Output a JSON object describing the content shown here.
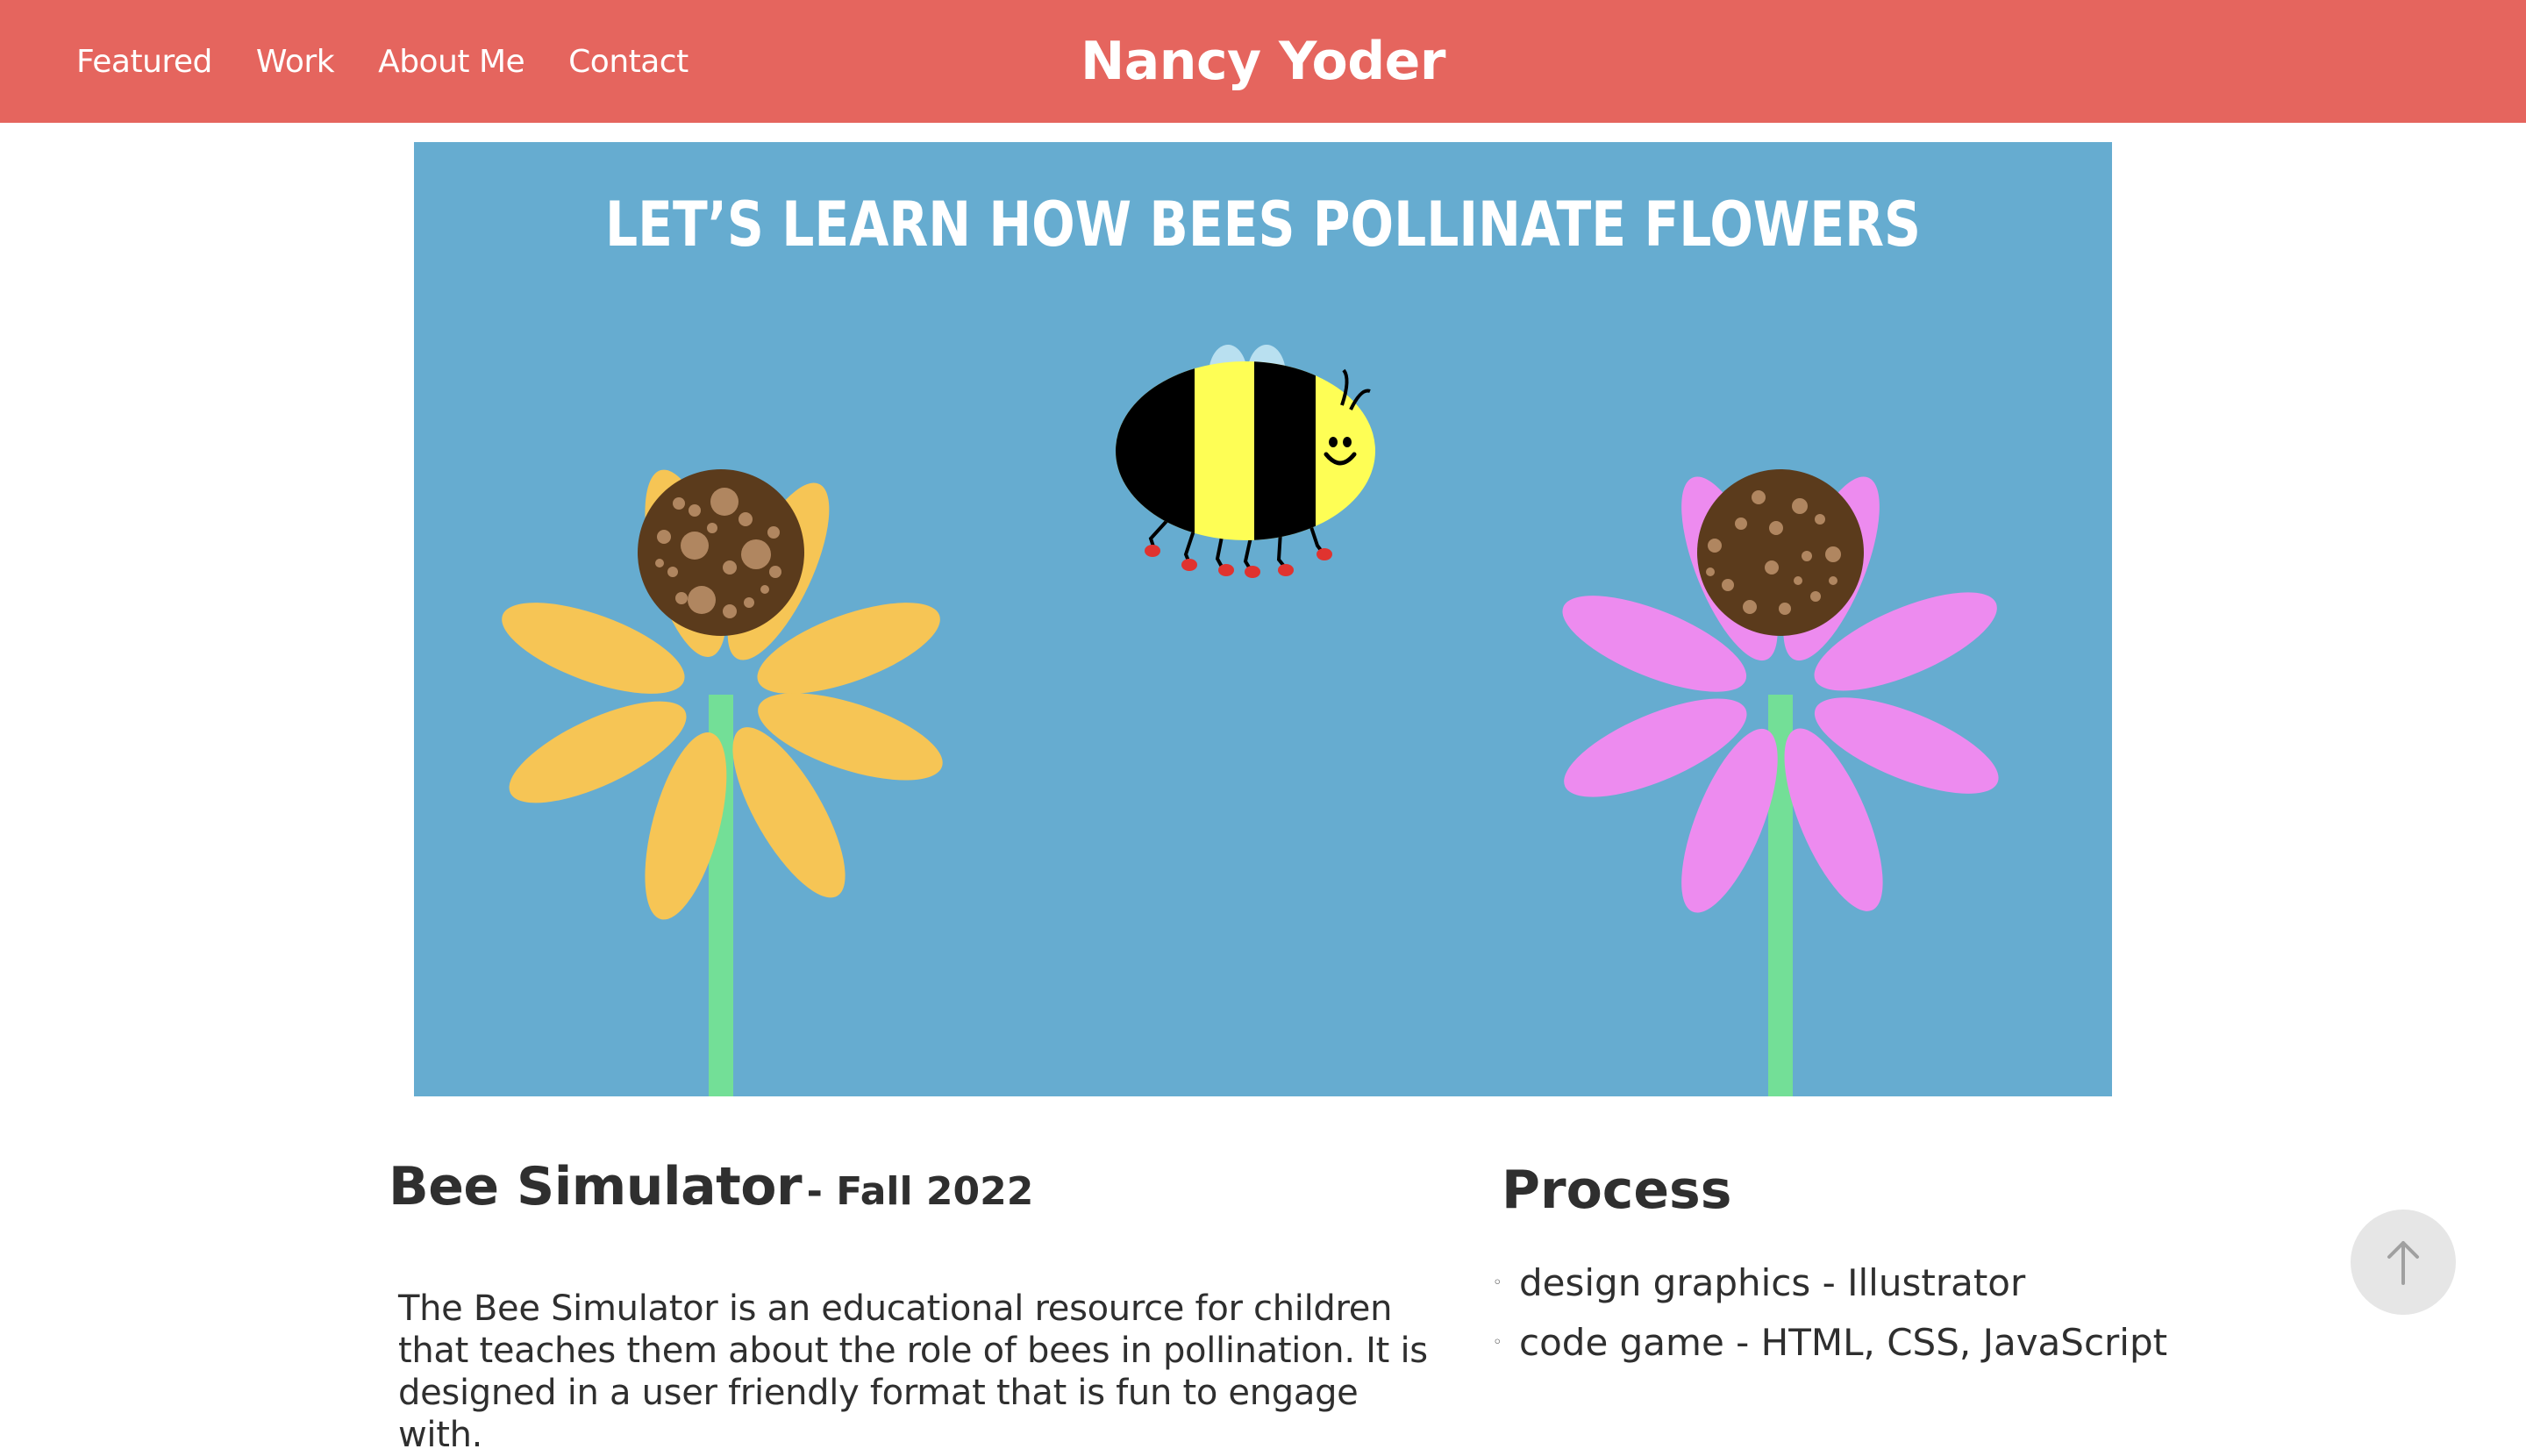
{
  "header": {
    "nav": [
      "Featured",
      "Work",
      "About Me",
      "Contact"
    ],
    "brand": "Nancy Yoder"
  },
  "hero": {
    "title": "LET’S LEARN HOW BEES POLLINATE FLOWERS",
    "background_color": "#66acd0",
    "sunflower_petal_color": "#f6c555",
    "pink_flower_petal_color": "#ed8bef",
    "flower_center_color": "#5b3b1c",
    "stem_color": "#73df97",
    "bee_yellow": "#fefe55"
  },
  "project": {
    "name": "Bee Simulator",
    "date": "- Fall 2022",
    "description": "The Bee Simulator is an educational resource for children that teaches them about the role of bees in pollination. It is designed in a user friendly format that is fun to engage with."
  },
  "process": {
    "heading": "Process",
    "items": [
      "design graphics - Illustrator",
      "code game - HTML, CSS, JavaScript"
    ]
  },
  "colors": {
    "header_bg": "#e5655e",
    "text": "#2f2f2f",
    "scroll_button_bg": "#e6e6e6"
  },
  "icons": {
    "scroll_top": "arrow-up-icon"
  }
}
